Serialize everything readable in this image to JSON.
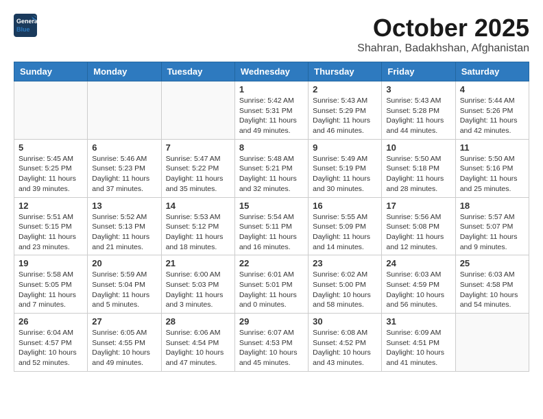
{
  "logo": {
    "general": "General",
    "blue": "Blue"
  },
  "title": "October 2025",
  "subtitle": "Shahran, Badakhshan, Afghanistan",
  "days_of_week": [
    "Sunday",
    "Monday",
    "Tuesday",
    "Wednesday",
    "Thursday",
    "Friday",
    "Saturday"
  ],
  "weeks": [
    [
      {
        "day": "",
        "info": ""
      },
      {
        "day": "",
        "info": ""
      },
      {
        "day": "",
        "info": ""
      },
      {
        "day": "1",
        "info": "Sunrise: 5:42 AM\nSunset: 5:31 PM\nDaylight: 11 hours\nand 49 minutes."
      },
      {
        "day": "2",
        "info": "Sunrise: 5:43 AM\nSunset: 5:29 PM\nDaylight: 11 hours\nand 46 minutes."
      },
      {
        "day": "3",
        "info": "Sunrise: 5:43 AM\nSunset: 5:28 PM\nDaylight: 11 hours\nand 44 minutes."
      },
      {
        "day": "4",
        "info": "Sunrise: 5:44 AM\nSunset: 5:26 PM\nDaylight: 11 hours\nand 42 minutes."
      }
    ],
    [
      {
        "day": "5",
        "info": "Sunrise: 5:45 AM\nSunset: 5:25 PM\nDaylight: 11 hours\nand 39 minutes."
      },
      {
        "day": "6",
        "info": "Sunrise: 5:46 AM\nSunset: 5:23 PM\nDaylight: 11 hours\nand 37 minutes."
      },
      {
        "day": "7",
        "info": "Sunrise: 5:47 AM\nSunset: 5:22 PM\nDaylight: 11 hours\nand 35 minutes."
      },
      {
        "day": "8",
        "info": "Sunrise: 5:48 AM\nSunset: 5:21 PM\nDaylight: 11 hours\nand 32 minutes."
      },
      {
        "day": "9",
        "info": "Sunrise: 5:49 AM\nSunset: 5:19 PM\nDaylight: 11 hours\nand 30 minutes."
      },
      {
        "day": "10",
        "info": "Sunrise: 5:50 AM\nSunset: 5:18 PM\nDaylight: 11 hours\nand 28 minutes."
      },
      {
        "day": "11",
        "info": "Sunrise: 5:50 AM\nSunset: 5:16 PM\nDaylight: 11 hours\nand 25 minutes."
      }
    ],
    [
      {
        "day": "12",
        "info": "Sunrise: 5:51 AM\nSunset: 5:15 PM\nDaylight: 11 hours\nand 23 minutes."
      },
      {
        "day": "13",
        "info": "Sunrise: 5:52 AM\nSunset: 5:13 PM\nDaylight: 11 hours\nand 21 minutes."
      },
      {
        "day": "14",
        "info": "Sunrise: 5:53 AM\nSunset: 5:12 PM\nDaylight: 11 hours\nand 18 minutes."
      },
      {
        "day": "15",
        "info": "Sunrise: 5:54 AM\nSunset: 5:11 PM\nDaylight: 11 hours\nand 16 minutes."
      },
      {
        "day": "16",
        "info": "Sunrise: 5:55 AM\nSunset: 5:09 PM\nDaylight: 11 hours\nand 14 minutes."
      },
      {
        "day": "17",
        "info": "Sunrise: 5:56 AM\nSunset: 5:08 PM\nDaylight: 11 hours\nand 12 minutes."
      },
      {
        "day": "18",
        "info": "Sunrise: 5:57 AM\nSunset: 5:07 PM\nDaylight: 11 hours\nand 9 minutes."
      }
    ],
    [
      {
        "day": "19",
        "info": "Sunrise: 5:58 AM\nSunset: 5:05 PM\nDaylight: 11 hours\nand 7 minutes."
      },
      {
        "day": "20",
        "info": "Sunrise: 5:59 AM\nSunset: 5:04 PM\nDaylight: 11 hours\nand 5 minutes."
      },
      {
        "day": "21",
        "info": "Sunrise: 6:00 AM\nSunset: 5:03 PM\nDaylight: 11 hours\nand 3 minutes."
      },
      {
        "day": "22",
        "info": "Sunrise: 6:01 AM\nSunset: 5:01 PM\nDaylight: 11 hours\nand 0 minutes."
      },
      {
        "day": "23",
        "info": "Sunrise: 6:02 AM\nSunset: 5:00 PM\nDaylight: 10 hours\nand 58 minutes."
      },
      {
        "day": "24",
        "info": "Sunrise: 6:03 AM\nSunset: 4:59 PM\nDaylight: 10 hours\nand 56 minutes."
      },
      {
        "day": "25",
        "info": "Sunrise: 6:03 AM\nSunset: 4:58 PM\nDaylight: 10 hours\nand 54 minutes."
      }
    ],
    [
      {
        "day": "26",
        "info": "Sunrise: 6:04 AM\nSunset: 4:57 PM\nDaylight: 10 hours\nand 52 minutes."
      },
      {
        "day": "27",
        "info": "Sunrise: 6:05 AM\nSunset: 4:55 PM\nDaylight: 10 hours\nand 49 minutes."
      },
      {
        "day": "28",
        "info": "Sunrise: 6:06 AM\nSunset: 4:54 PM\nDaylight: 10 hours\nand 47 minutes."
      },
      {
        "day": "29",
        "info": "Sunrise: 6:07 AM\nSunset: 4:53 PM\nDaylight: 10 hours\nand 45 minutes."
      },
      {
        "day": "30",
        "info": "Sunrise: 6:08 AM\nSunset: 4:52 PM\nDaylight: 10 hours\nand 43 minutes."
      },
      {
        "day": "31",
        "info": "Sunrise: 6:09 AM\nSunset: 4:51 PM\nDaylight: 10 hours\nand 41 minutes."
      },
      {
        "day": "",
        "info": ""
      }
    ]
  ]
}
